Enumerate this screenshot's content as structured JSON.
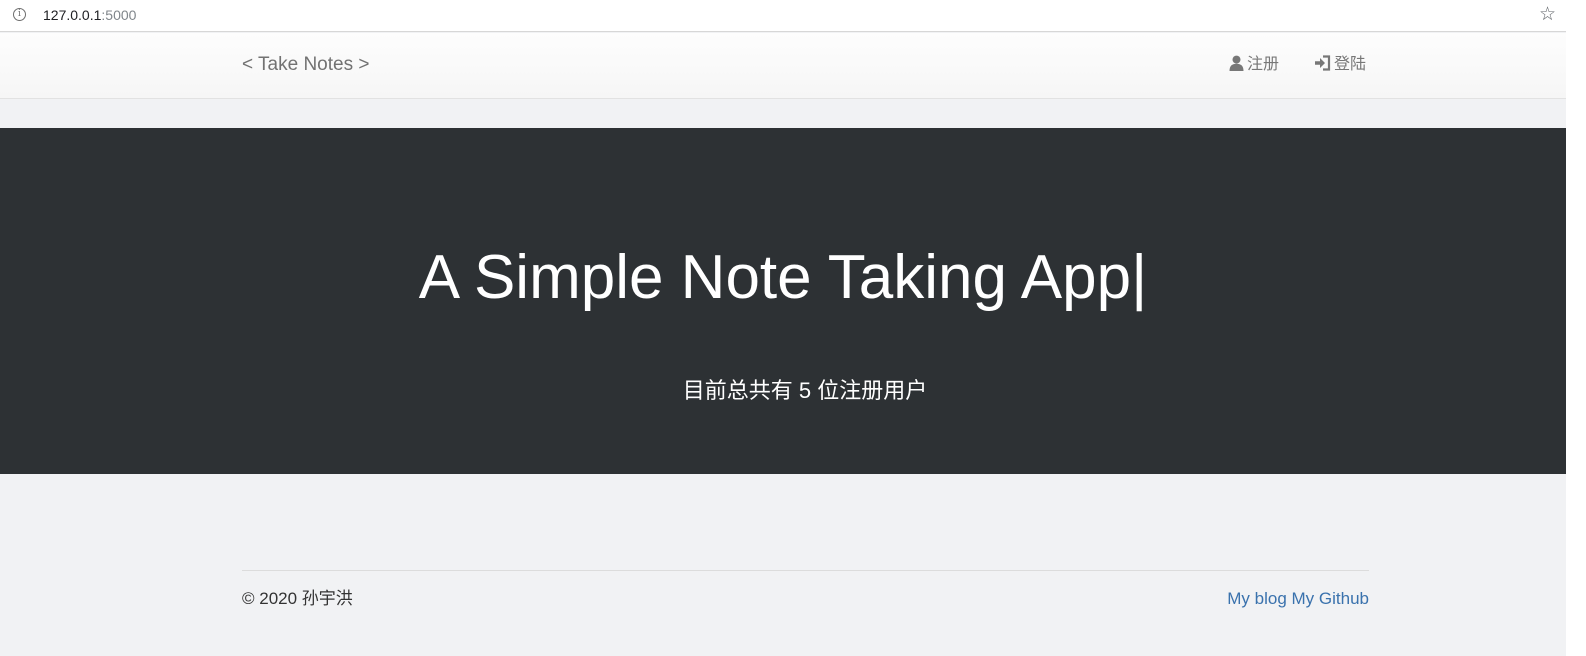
{
  "browser": {
    "url_host": "127.0.0.1",
    "url_port": ":5000",
    "info_icon": "info-icon",
    "bookmark_icon": "star-icon",
    "bookmark_glyph": "☆"
  },
  "navbar": {
    "brand": "< Take Notes >",
    "register_label": "注册",
    "login_label": "登陆"
  },
  "hero": {
    "title": "A Simple Note Taking App",
    "caret": "|",
    "user_count_text": "目前总共有 5 位注册用户"
  },
  "footer": {
    "copyright": "© 2020 孙宇洪",
    "blog_link": "My blog",
    "github_link": "My Github"
  },
  "colors": {
    "hero_background": "#2d3134",
    "link": "#3a72ad",
    "page_background": "#f1f2f4"
  }
}
